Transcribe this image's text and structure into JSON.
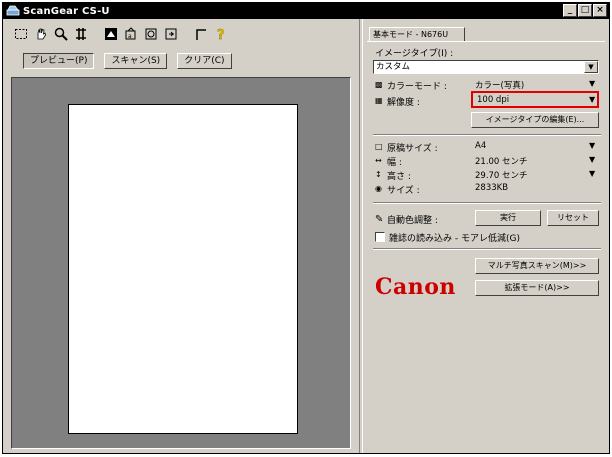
{
  "window": {
    "title": "ScanGear CS-U",
    "minimize": "_",
    "maximize": "□",
    "close": "×"
  },
  "left": {
    "tabs": [
      "プレビュー(P)",
      "スキャン(S)",
      "クリア(C)"
    ]
  },
  "right": {
    "mode_tab": "基本モード - N676U",
    "image_type_label": "イメージタイプ(I) :",
    "image_type_value": "カスタム",
    "color_mode_label": "カラーモード :",
    "color_mode_value": "カラー(写真)",
    "resolution_label": "解像度 :",
    "resolution_value": "100 dpi",
    "edit_image_type_button": "イメージタイプの編集(E)...",
    "doc_size_label": "原稿サイズ :",
    "doc_size_value": "A4",
    "width_label": "幅 :",
    "width_value": "21.00 センチ",
    "height_label": "高さ :",
    "height_value": "29.70 センチ",
    "size_label": "サイズ :",
    "size_value": "2833KB",
    "auto_color_label": "自動色調整 :",
    "execute_button": "実行",
    "reset_button": "リセット",
    "moire_label": "雑誌の読み込み - モアレ低減(G)",
    "multi_photo_button": "マルチ写真スキャン(M)>>",
    "advanced_mode_button": "拡張モード(A)>>",
    "brand": "Canon"
  },
  "colors": {
    "highlight_box": "#e00000",
    "brand": "#cc0000"
  },
  "icons": [
    "scanner-icon",
    "select-frame-icon",
    "hand-icon",
    "zoom-icon",
    "trim-icon",
    "mirror-icon",
    "rotate-left-icon",
    "rotate-right-icon",
    "auto-crop-icon",
    "help-icon"
  ]
}
